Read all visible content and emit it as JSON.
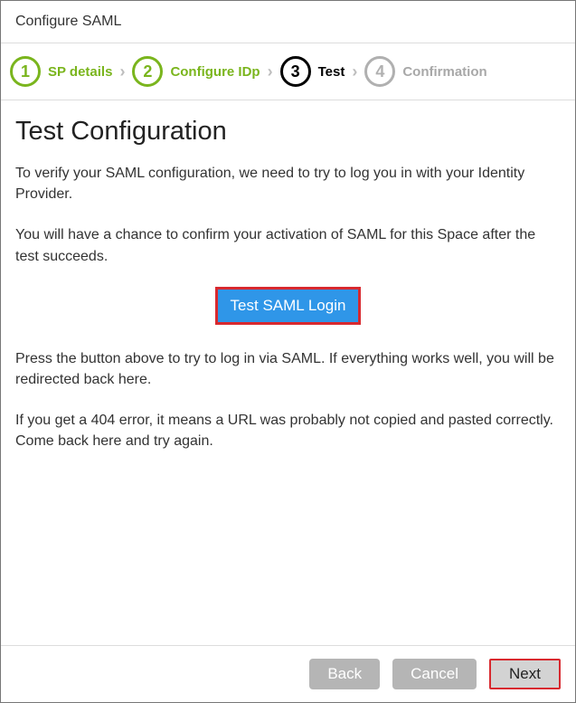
{
  "header": {
    "title": "Configure SAML"
  },
  "stepper": {
    "steps": [
      {
        "num": "1",
        "label": "SP details"
      },
      {
        "num": "2",
        "label": "Configure IDp"
      },
      {
        "num": "3",
        "label": "Test"
      },
      {
        "num": "4",
        "label": "Confirmation"
      }
    ]
  },
  "content": {
    "heading": "Test Configuration",
    "para1": "To verify your SAML configuration, we need to try to log you in with your Identity Provider.",
    "para2": "You will have a chance to confirm your activation of SAML for this Space after the test succeeds.",
    "test_button": "Test SAML Login",
    "para3": "Press the button above to try to log in via SAML. If everything works well, you will be redirected back here.",
    "para4": "If you get a 404 error, it means a URL was probably not copied and pasted correctly. Come back here and try again."
  },
  "footer": {
    "back": "Back",
    "cancel": "Cancel",
    "next": "Next"
  }
}
